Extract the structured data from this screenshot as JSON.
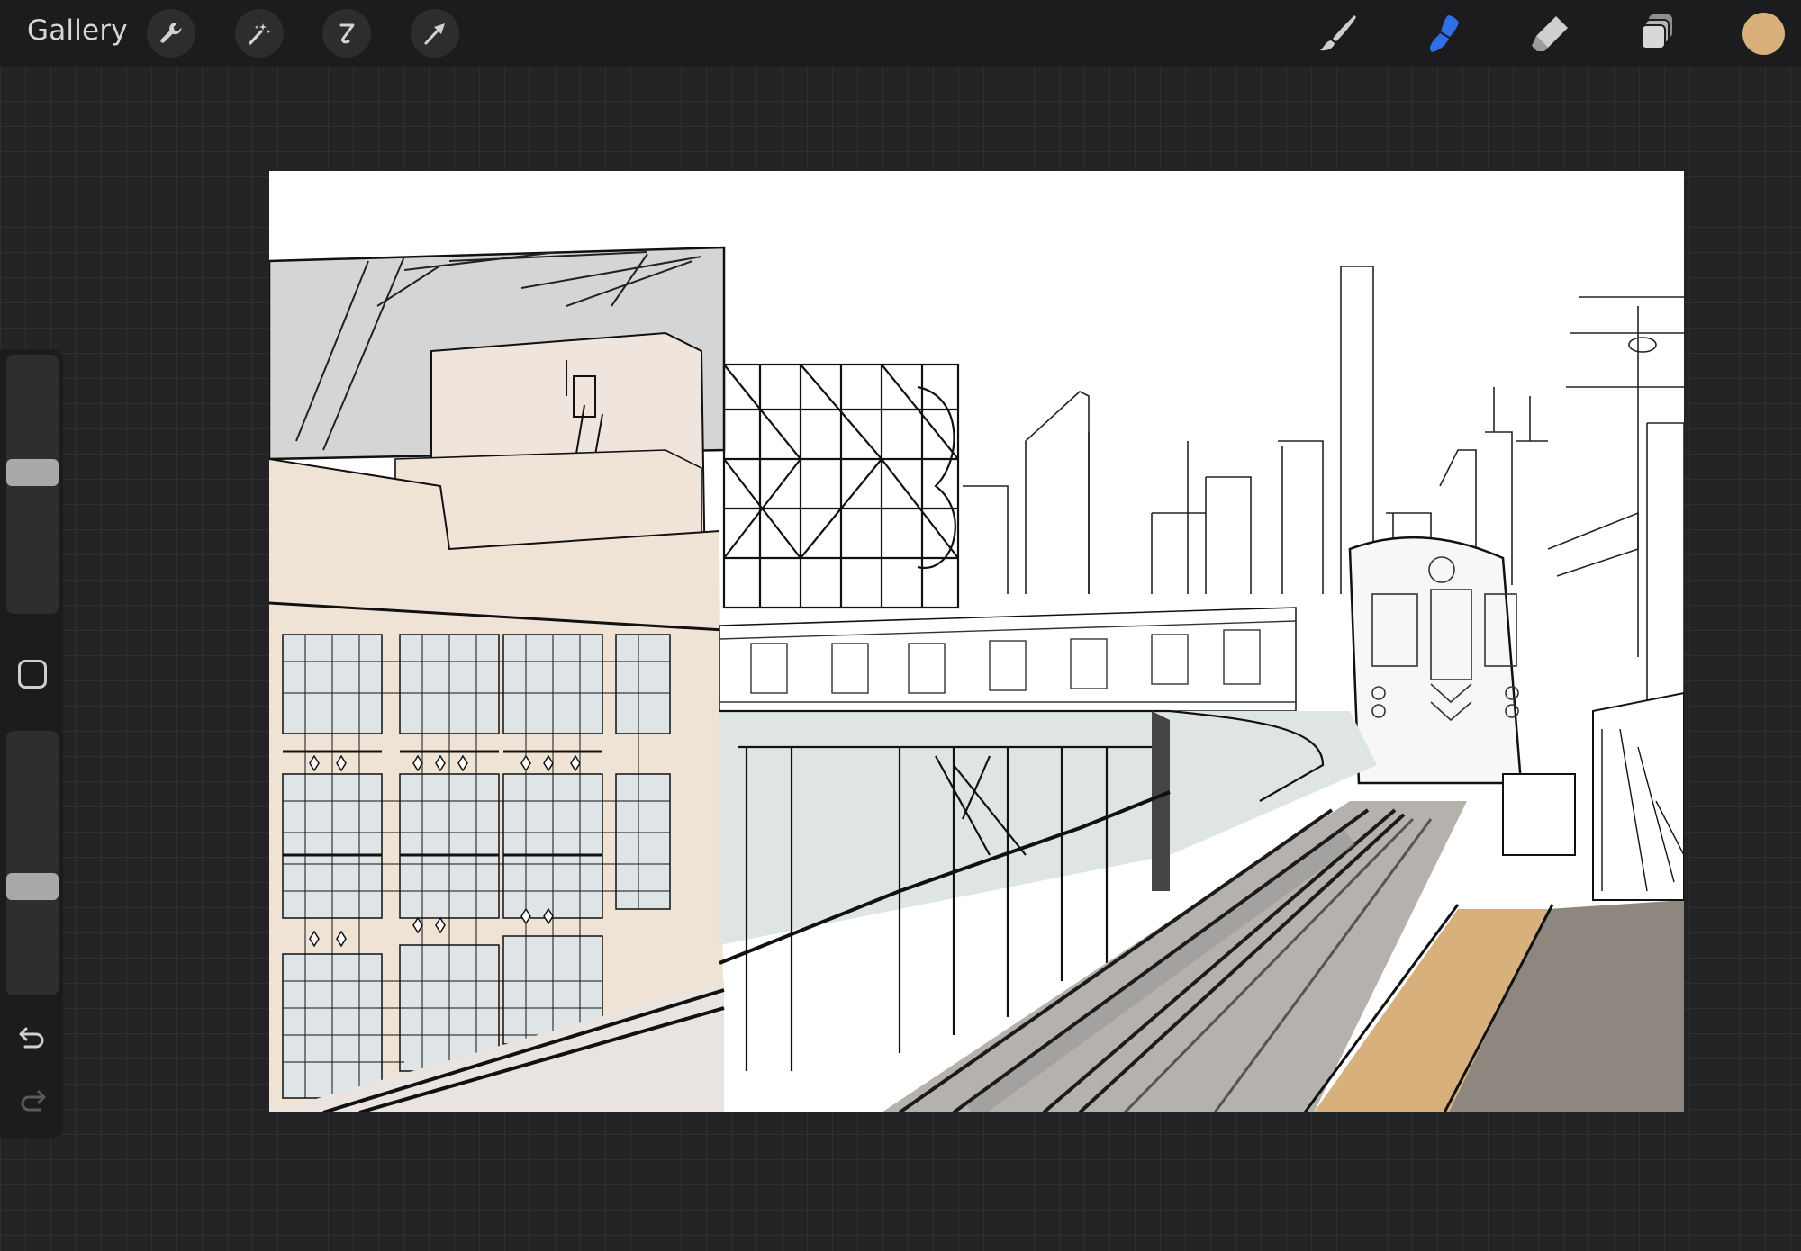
{
  "topbar": {
    "gallery_label": "Gallery",
    "left_tools": [
      "wrench-icon",
      "magic-wand-icon",
      "selection-icon",
      "transform-arrow-icon"
    ],
    "right_tools": [
      "brush-icon",
      "smudge-icon",
      "eraser-icon",
      "layers-icon"
    ],
    "active_tool": "smudge",
    "active_color": "#d9b07a",
    "accent_color": "#2f6fe8"
  },
  "sidebar": {
    "brush_size_level": 0.55,
    "opacity_level": 0.4,
    "icons": [
      "modify-square-icon",
      "undo-icon",
      "redo-icon"
    ]
  },
  "canvas": {
    "description_colors": {
      "platform": "#d8b07c",
      "building": "#efe4d8",
      "sky": "#ffffff",
      "ground": "#8d8780"
    }
  }
}
